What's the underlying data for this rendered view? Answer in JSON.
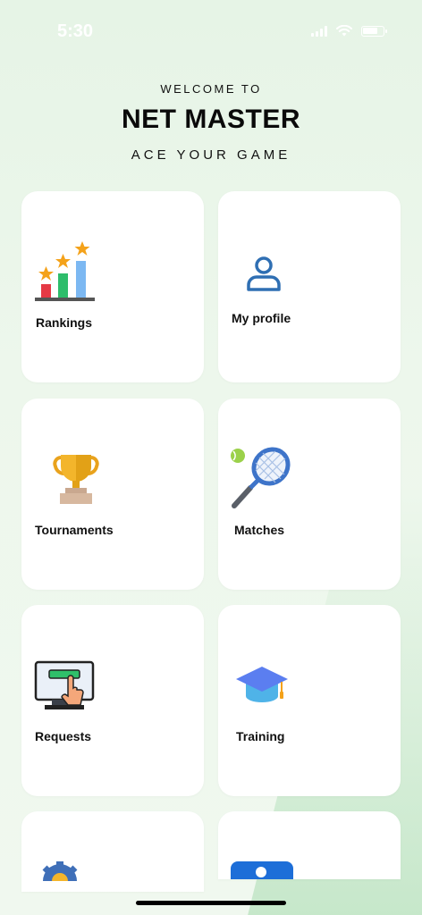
{
  "status_bar": {
    "time": "5:30"
  },
  "header": {
    "welcome": "WELCOME TO",
    "title": "NET MASTER",
    "tagline": "ACE YOUR GAME"
  },
  "menu": {
    "rankings": {
      "label": "Rankings",
      "icon": "rankings-bar-chart-stars-icon"
    },
    "my_profile": {
      "label": "My profile",
      "icon": "user-profile-icon"
    },
    "tournaments": {
      "label": "Tournaments",
      "icon": "trophy-icon"
    },
    "matches": {
      "label": "Matches",
      "icon": "tennis-racket-ball-icon"
    },
    "requests": {
      "label": "Requests",
      "icon": "monitor-click-icon"
    },
    "training": {
      "label": "Training",
      "icon": "graduation-cap-icon"
    },
    "settings": {
      "icon": "gear-icon"
    },
    "contacts": {
      "icon": "contact-card-icon"
    }
  },
  "colors": {
    "background": "#e8f5e8",
    "card": "#ffffff",
    "profile_blue": "#2f6fb3",
    "accent_green": "#3cb371"
  }
}
